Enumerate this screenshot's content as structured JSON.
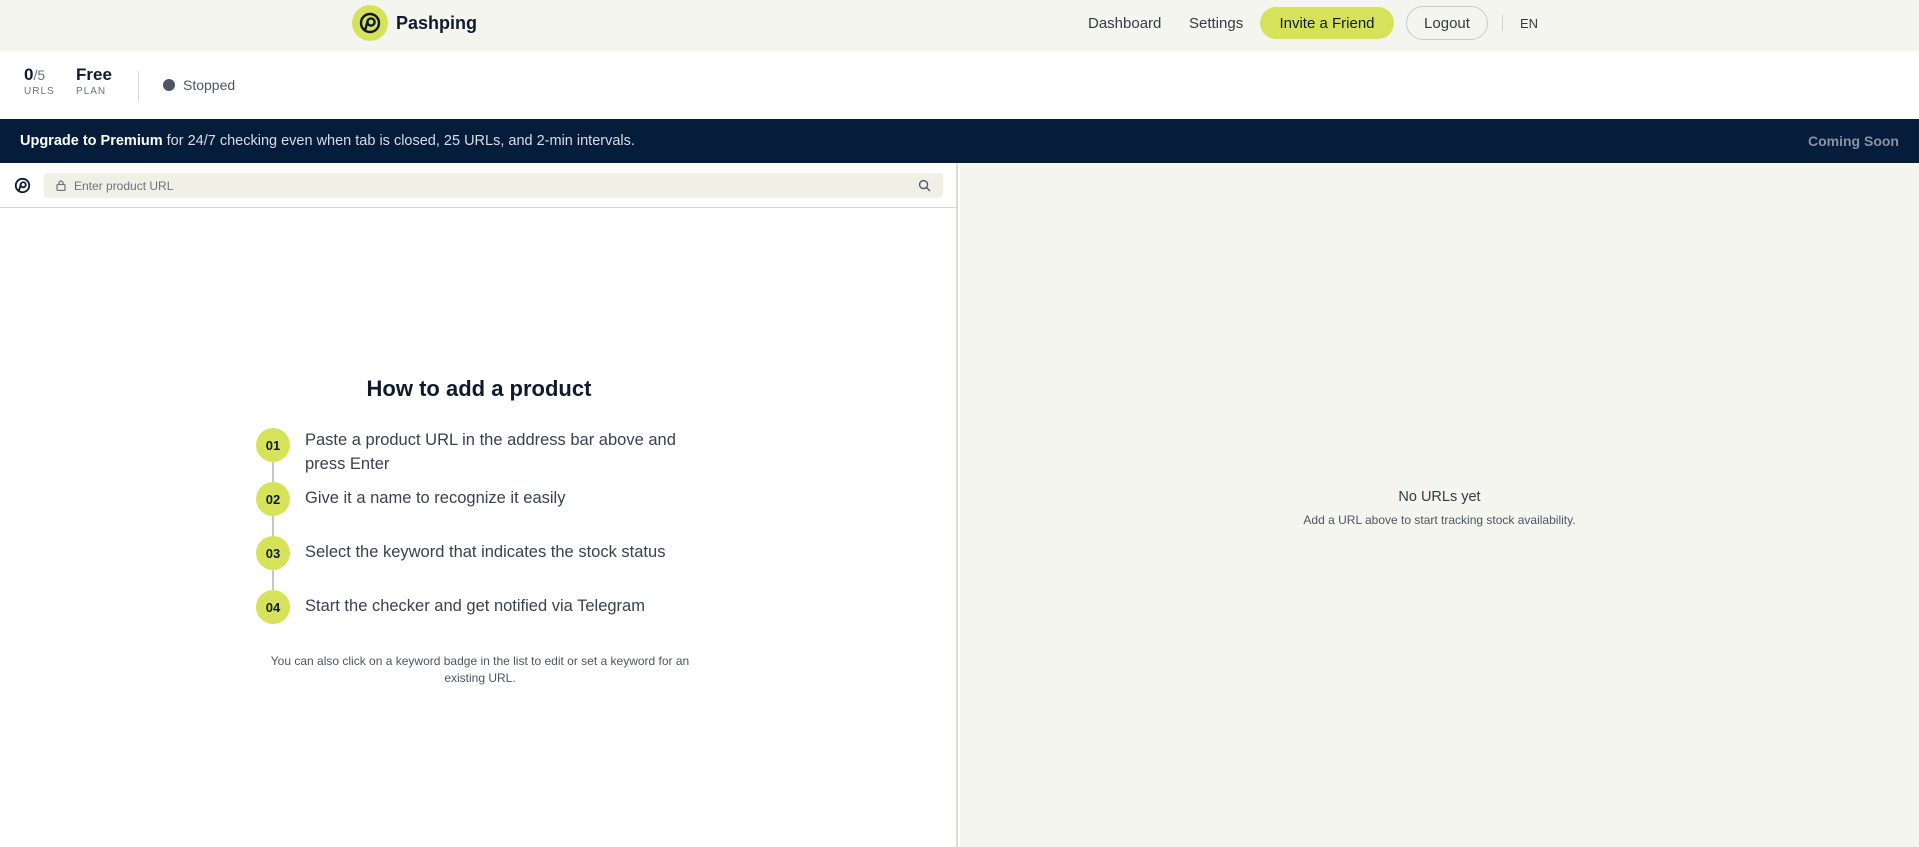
{
  "app": {
    "name": "Pashping",
    "logo_icon": "pashping-logo-icon",
    "accent": "#d6e35a",
    "dark": "#051c3b"
  },
  "nav": {
    "dashboard": "Dashboard",
    "settings": "Settings",
    "invite": "Invite a Friend",
    "logout": "Logout",
    "language": "EN"
  },
  "stats": {
    "urls_count": "0",
    "urls_max": "/5",
    "urls_caption": "URLS",
    "plan_value": "Free",
    "plan_caption": "PLAN",
    "status": "Stopped"
  },
  "banner": {
    "highlight": "Upgrade to Premium",
    "text": " for 24/7 checking even when tab is closed, 25 URLs, and 2-min intervals.",
    "action": "Coming Soon"
  },
  "urlbar": {
    "placeholder": "Enter product URL",
    "value": ""
  },
  "howto": {
    "title": "How to add a product",
    "steps": [
      {
        "num": "01",
        "text": "Paste a product URL in the address bar above and press Enter"
      },
      {
        "num": "02",
        "text": "Give it a name to recognize it easily"
      },
      {
        "num": "03",
        "text": "Select the keyword that indicates the stock status"
      },
      {
        "num": "04",
        "text": "Start the checker and get notified via Telegram"
      }
    ],
    "note": "You can also click on a keyword badge in the list to edit or set a keyword for an existing URL."
  },
  "empty": {
    "title": "No URLs yet",
    "subtitle": "Add a URL above to start tracking stock availability."
  }
}
